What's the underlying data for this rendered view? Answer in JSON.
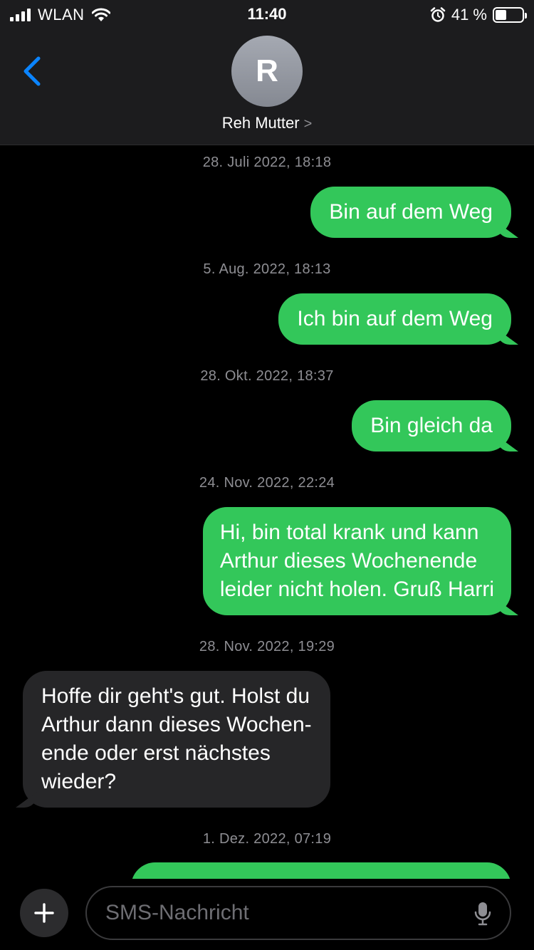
{
  "status_bar": {
    "carrier": "WLAN",
    "time": "11:40",
    "battery": "41 %",
    "battery_level": 0.41
  },
  "header": {
    "avatar_initial": "R",
    "contact_name": "Reh Mutter",
    "chevron": ">"
  },
  "messages": [
    {
      "timestamp": "28. Juli 2022, 18:18",
      "text": "Bin auf dem Weg",
      "direction": "outgoing"
    },
    {
      "timestamp": "5. Aug. 2022, 18:13",
      "text": "Ich bin auf dem Weg",
      "direction": "outgoing"
    },
    {
      "timestamp": "28. Okt. 2022, 18:37",
      "text": "Bin gleich da",
      "direction": "outgoing"
    },
    {
      "timestamp": "24. Nov. 2022, 22:24",
      "lines": [
        "Hi, bin total krank und kann",
        "Arthur dieses Wochenende",
        "leider nicht holen. Gruß Harri"
      ],
      "direction": "outgoing"
    },
    {
      "timestamp": "28. Nov. 2022, 19:29",
      "lines": [
        "Hoffe dir geht's gut. Holst du",
        "Arthur dann dieses Wochen-",
        "ende oder erst nächstes",
        "wieder?"
      ],
      "direction": "incoming"
    },
    {
      "timestamp": "1. Dez. 2022, 07:19",
      "direction": "outgoing"
    }
  ],
  "input": {
    "placeholder": "SMS-Nachricht"
  },
  "colors": {
    "outgoing_bubble": "#33c75a",
    "incoming_bubble": "#262628",
    "accent": "#0a84ff",
    "background": "#000000"
  }
}
